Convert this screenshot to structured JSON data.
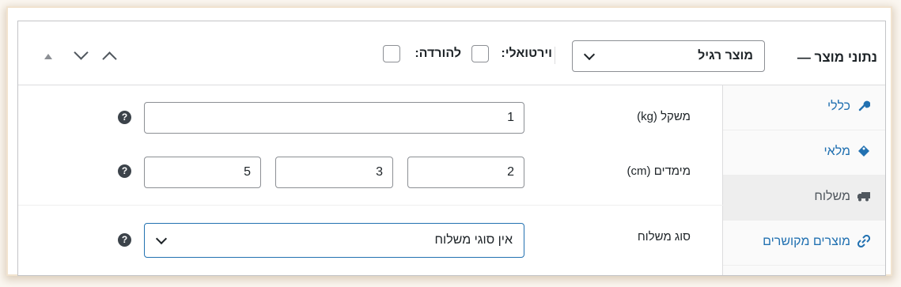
{
  "header": {
    "title": "נתוני מוצר —",
    "product_type": "מוצר רגיל",
    "virtual_label": "וירטואלי:",
    "download_label": "להורדה:"
  },
  "sidebar": {
    "items": [
      {
        "label": "כללי",
        "icon": "wrench-icon"
      },
      {
        "label": "מלאי",
        "icon": "tag-icon"
      },
      {
        "label": "משלוח",
        "icon": "truck-icon"
      },
      {
        "label": "מוצרים מקושרים",
        "icon": "link-icon"
      }
    ],
    "active_index": 2
  },
  "fields": {
    "weight_label": "משקל (kg)",
    "weight_value": "1",
    "dimensions_label": "מימדים (cm)",
    "length": "2",
    "width": "3",
    "height": "5",
    "shipping_class_label": "סוג משלוח",
    "shipping_class_value": "אין סוגי משלוח"
  },
  "help_glyph": "?",
  "colors": {
    "link": "#2271b1",
    "focus_border": "#2271b1"
  }
}
